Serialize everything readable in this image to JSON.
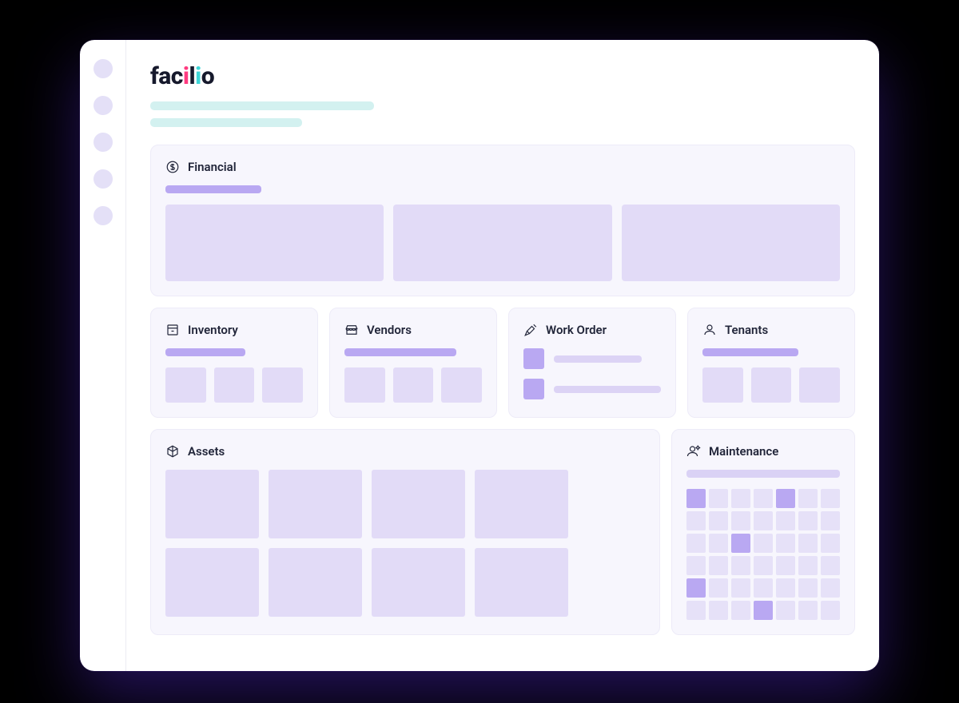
{
  "logo": {
    "text": "facilio"
  },
  "sidebar": {
    "item_count": 5
  },
  "sections": {
    "financial": {
      "label": "Financial",
      "icon": "dollar-icon"
    },
    "inventory": {
      "label": "Inventory",
      "icon": "archive-icon"
    },
    "vendors": {
      "label": "Vendors",
      "icon": "storefront-icon"
    },
    "work_order": {
      "label": "Work Order",
      "icon": "tools-icon"
    },
    "tenants": {
      "label": "Tenants",
      "icon": "person-icon"
    },
    "assets": {
      "label": "Assets",
      "icon": "cube-icon"
    },
    "maintenance": {
      "label": "Maintenance",
      "icon": "engineer-icon"
    }
  },
  "calendar": {
    "rows": 6,
    "cols": 7,
    "active_cells": [
      0,
      4,
      16,
      28,
      38
    ]
  },
  "colors": {
    "accent_light": "#e2dbf7",
    "accent_mid": "#b9a8f2",
    "teal_placeholder": "#d3f1f0",
    "card_bg": "#f7f6fd",
    "text": "#22263a"
  }
}
